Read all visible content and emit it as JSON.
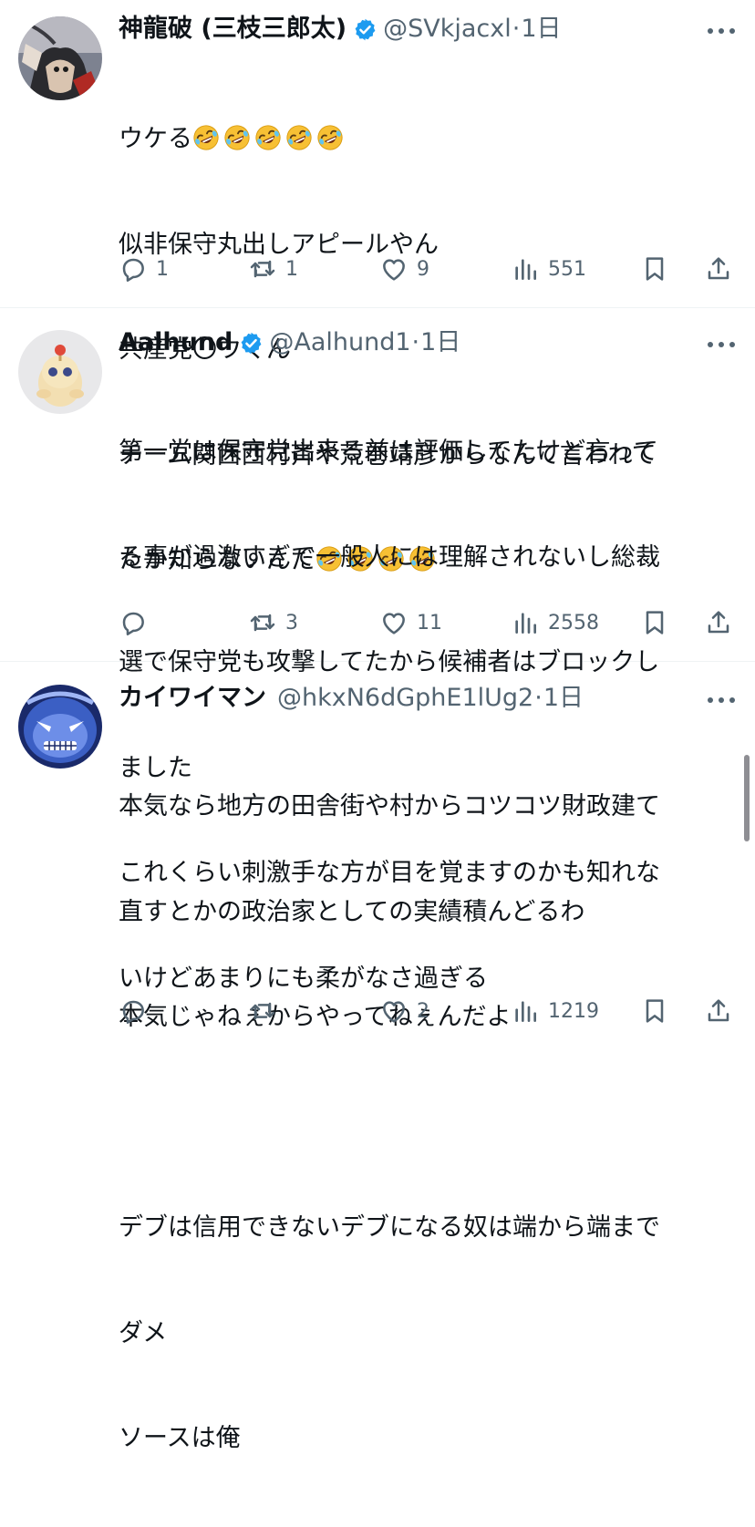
{
  "posts": [
    {
      "name": "神龍破 (三枝三郎太)",
      "verified": true,
      "handle": "@SVkjacxl",
      "time": "1日",
      "body_lines": [
        "ウケる🤣🤣🤣🤣🤣",
        "似非保守丸出しアピールやん",
        "共産党〇ウくん",
        "チーム関西西村斉や荒巻靖彦からなんて言われて",
        "たか知らないんだ🤣🤣🤣🤣"
      ],
      "replies": "1",
      "reposts": "1",
      "likes": "9",
      "views": "551",
      "avatar_icon": "demon-artwork-avatar"
    },
    {
      "name": "Aalhund",
      "verified": true,
      "handle": "@Aalhund1",
      "time": "1日",
      "body_lines": [
        "第一党は保守党出来る前は評価してたけど言って",
        "る事が過激すぎて一般人には理解されないし総裁",
        "選で保守党も攻撃してたから候補者はブロックし",
        "ました",
        "これくらい刺激手な方が目を覚ますのかも知れな",
        "いけどあまりにも柔がなさ過ぎる"
      ],
      "replies": "",
      "reposts": "3",
      "likes": "11",
      "views": "2558",
      "avatar_icon": "figurine-avatar"
    },
    {
      "name": "カイワイマン",
      "verified": false,
      "handle": "@hkxN6dGphE1lUg2",
      "time": "1日",
      "body_lines": [
        "本気なら地方の田舎街や村からコツコツ財政建て",
        "直すとかの政治家としての実績積んどるわ",
        "本気じゃねぇからやってねぇんだよ",
        "",
        "デブは信用できないデブになる奴は端から端まで",
        "ダメ",
        "ソースは俺"
      ],
      "replies": "",
      "reposts": "",
      "likes": "2",
      "views": "1219",
      "avatar_icon": "blue-monster-avatar"
    }
  ],
  "separator": "·",
  "colors": {
    "verified": "#1d9bf0",
    "secondary_text": "#536471",
    "divider": "#eff3f4"
  }
}
